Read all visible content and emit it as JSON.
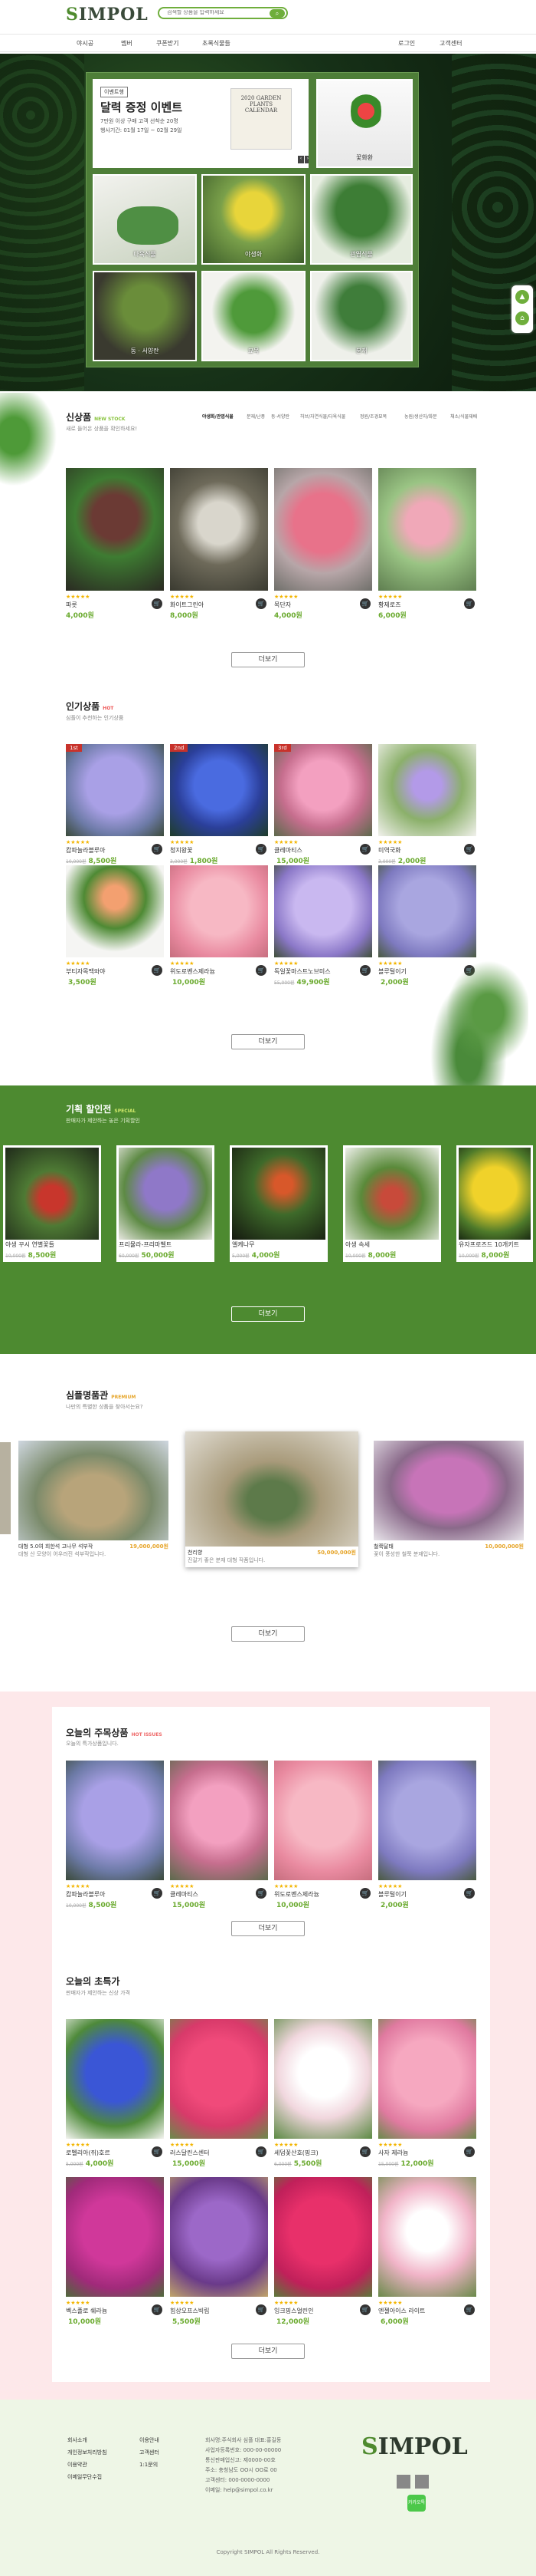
{
  "header": {
    "logo": "IMPOL",
    "logo_initial": "S",
    "search_placeholder": "검색할 상품을 입력하세요",
    "search_icon": "search-icon"
  },
  "nav": {
    "items": [
      "야시공",
      "멤버",
      "쿠폰받기",
      "초록식물들"
    ],
    "right_items": [
      "로그인",
      "고객센터"
    ]
  },
  "hero": {
    "promo_tag": "이벤트행",
    "promo_title": "달력 증정 이벤트",
    "promo_desc": "7만원 이상 구매 고객 선착순 20명",
    "promo_period": "행사기간: 01월 17일 ~ 02월 29일",
    "promo_book": "2020 GARDEN PLANTS CALENDAR",
    "tiles": [
      "꽃화환",
      "다육식물",
      "야생화",
      "관엽식물",
      "동 · 서양란",
      "묘목",
      "분재"
    ]
  },
  "new_products": {
    "title": "신상품",
    "title_en": "NEW STOCK",
    "subtitle": "새로 들어온 상품을 확인하세요!",
    "categories": [
      "야생화/관엽식물",
      "분재/난풍",
      "동·서양란",
      "허브/자연식물/다육식물",
      "정원/조경묘목",
      "농원/생산자/화분",
      "채소/식물재배"
    ],
    "items": [
      {
        "name": "파릇",
        "price": "4,000원"
      },
      {
        "name": "화이트그린아",
        "price": "8,000원"
      },
      {
        "name": "목단자",
        "price": "4,000원"
      },
      {
        "name": "황제로즈",
        "price": "6,000원"
      }
    ],
    "more": "더보기"
  },
  "popular": {
    "title": "인기상품",
    "title_en": "HOT",
    "subtitle": "심플이 추천하는 인기상품",
    "items": [
      {
        "rank": "1st",
        "name": "캄파눌라블루아",
        "old": "10,000원",
        "price": "8,500원"
      },
      {
        "rank": "2nd",
        "name": "청지왕꽃",
        "old": "3,000원",
        "price": "1,800원"
      },
      {
        "rank": "3rd",
        "name": "클레마티스",
        "old": "",
        "price": "15,000원"
      },
      {
        "rank": "",
        "name": "미역국화",
        "old": "3,000원",
        "price": "2,000원"
      },
      {
        "rank": "",
        "name": "부티자목맥와야",
        "old": "",
        "price": "3,500원"
      },
      {
        "rank": "",
        "name": "위도로벤스제라늄",
        "old": "",
        "price": "10,000원"
      },
      {
        "rank": "",
        "name": "독일꽃마스트노브미스",
        "old": "55,000원",
        "price": "49,900원"
      },
      {
        "rank": "",
        "name": "블루털이기",
        "old": "",
        "price": "2,000원"
      }
    ],
    "more": "더보기"
  },
  "special": {
    "title": "기획 할인전",
    "title_en": "SPECIAL",
    "subtitle": "판매자가 제안하는 놓은 기획할인",
    "items": [
      {
        "name": "야생 꾸시 연별꽃들",
        "old": "10,000원",
        "price": "8,500원"
      },
      {
        "name": "프리뮬라-프리마벨트",
        "old": "60,000원",
        "price": "50,000원"
      },
      {
        "name": "엘케나무",
        "old": "5,000원",
        "price": "4,000원"
      },
      {
        "name": "아생 속세",
        "old": "10,000원",
        "price": "8,000원"
      },
      {
        "name": "유자프로즈드 10개키트",
        "old": "10,000원",
        "price": "8,000원"
      }
    ],
    "more": "더보기"
  },
  "premium": {
    "title": "심플명품관",
    "title_en": "PREMIUM",
    "subtitle": "나만의 특별한 상품을 찾아서는요?",
    "items": [
      {
        "name": "대형 5.0여 희한석 고나무 석부작",
        "price": "19,000,000원",
        "desc": "대형 산 모양이 어우러진 석부작입니다."
      },
      {
        "name": "천리향",
        "price": "50,000,000원",
        "desc": "진갈기 좋은 분재 대형 작품입니다."
      },
      {
        "name": "철쭉달태",
        "price": "10,000,000원",
        "desc": "꽃이 풍성한 철쭉 분재입니다."
      }
    ],
    "more": "더보기"
  },
  "today": {
    "title": "오늘의 주목상품",
    "title_en": "HOT ISSUES",
    "subtitle": "오늘의 특가상품입니다.",
    "items": [
      {
        "name": "캄파눌라블루아",
        "old": "10,000원",
        "price": "8,500원"
      },
      {
        "name": "클레마티스",
        "old": "",
        "price": "15,000원"
      },
      {
        "name": "위도로벤스제라늄",
        "old": "",
        "price": "10,000원"
      },
      {
        "name": "블루털이기",
        "old": "",
        "price": "2,000원"
      }
    ],
    "more": "더보기"
  },
  "flowers": {
    "title": "오늘의 초특가",
    "subtitle": "판매자가 제안하는 신상 가격",
    "items": [
      {
        "name": "로벨리아(쥐)호르",
        "old": "5,000원",
        "price": "4,000원"
      },
      {
        "name": "러스달린스센터",
        "old": "",
        "price": "15,000원"
      },
      {
        "name": "세덤꽃산호(핑크)",
        "old": "6,000원",
        "price": "5,500원"
      },
      {
        "name": "사자 제라늄",
        "old": "15,000원",
        "price": "12,000원"
      },
      {
        "name": "벡스플로 쉐라늄",
        "old": "",
        "price": "10,000원"
      },
      {
        "name": "힘상오프스빅립",
        "old": "",
        "price": "5,500원"
      },
      {
        "name": "잉크핑스얼린인",
        "old": "",
        "price": "12,000원"
      },
      {
        "name": "엔젤아이스 라이트",
        "old": "",
        "price": "6,000원"
      }
    ],
    "more": "더보기"
  },
  "footer": {
    "col1": [
      "회사소개",
      "개인정보처리방침",
      "이용약관",
      "이메일무단수집"
    ],
    "col2": [
      "이용안내",
      "고객센터",
      "1:1문의"
    ],
    "info": [
      "회사명:주식회사 심플 대표:홍길동",
      "사업자등록번호: 000-00-00000",
      "통신판매업신고: 제0000-00호",
      "주소: 충청남도 OO시 OO로 00",
      "고객센터: 000-0000-0000",
      "이메일: help@simpol.co.kr"
    ],
    "copyright": "Copyright SIMPOL All Rights Reserved.",
    "logo": "IMPOL",
    "logo_initial": "S",
    "kakao": "카카오톡"
  },
  "colors": {
    "accent": "#6fae3c",
    "band": "#4d8a30",
    "pink_bg": "#fde8ea"
  }
}
